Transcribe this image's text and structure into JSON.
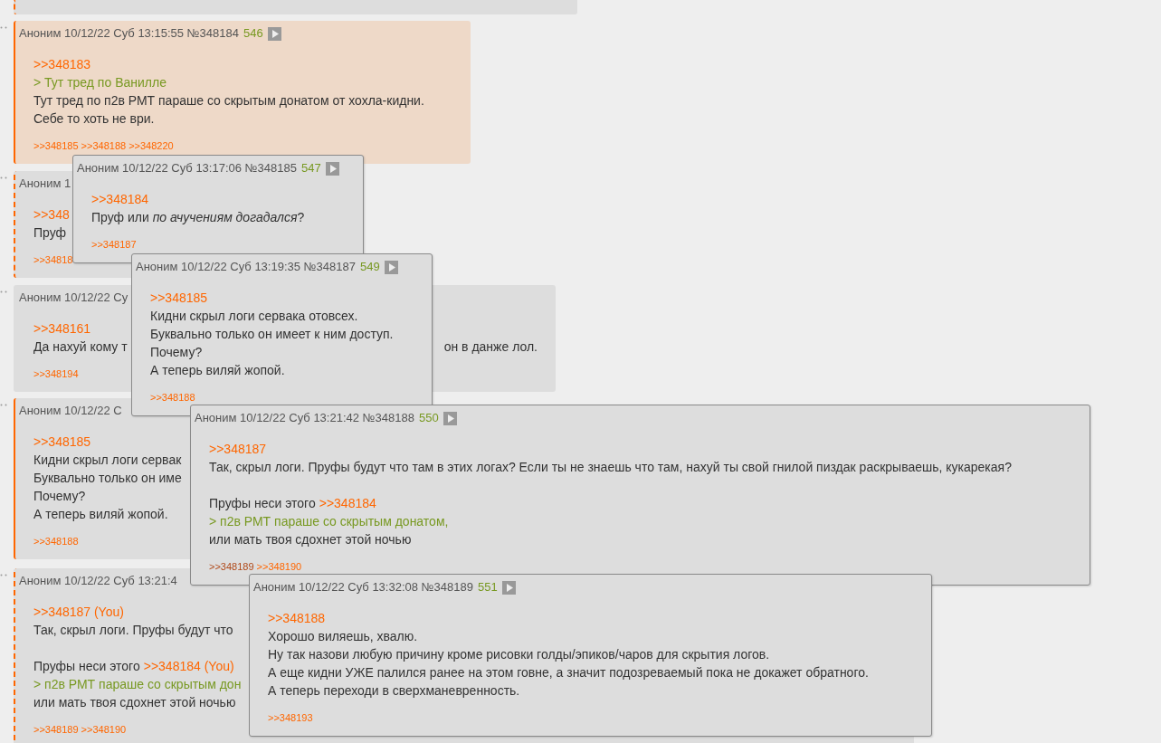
{
  "thread": [
    {
      "kind": "dashed",
      "highlighted": false
    },
    {
      "kind": "solid",
      "highlighted": true,
      "header": {
        "text": "Аноним 10/12/22 Суб 13:15:55 №348184",
        "count": "546"
      },
      "lines": [
        {
          "parts": [
            {
              "kind": "link",
              "text": ">>348183"
            }
          ]
        },
        {
          "parts": [
            {
              "kind": "quote",
              "text": "> Тут тред по Ванилле"
            }
          ]
        },
        {
          "parts": [
            {
              "kind": "text",
              "text": "Тут тред по п2в РМТ параше со скрытым донатом от хохла-кидни."
            }
          ]
        },
        {
          "parts": [
            {
              "kind": "text",
              "text": "Себе то хоть не ври."
            }
          ]
        }
      ],
      "replies": [
        {
          "text": ">>348185",
          "visited": false
        },
        {
          "text": ">>348188",
          "visited": false
        },
        {
          "text": ">>348220",
          "visited": false
        }
      ]
    },
    {
      "kind": "dashed",
      "highlighted": false,
      "header": {
        "text": "Аноним 1"
      },
      "lines": [
        {
          "parts": [
            {
              "kind": "link",
              "text": ">>348"
            }
          ]
        },
        {
          "parts": [
            {
              "kind": "text",
              "text": "Пруф"
            }
          ]
        }
      ],
      "replies": [
        {
          "text": ">>34818",
          "visited": false
        }
      ]
    },
    {
      "kind": "plain",
      "highlighted": false,
      "header": {
        "text": "Аноним 10/12/22 Су"
      },
      "lines": [
        {
          "parts": [
            {
              "kind": "link",
              "text": ">>348161"
            }
          ]
        },
        {
          "parts": [
            {
              "kind": "text",
              "text": "Да нахуй кому т"
            },
            {
              "kind": "text_end",
              "text": "он в данже лол."
            }
          ]
        }
      ],
      "replies": [
        {
          "text": ">>348194",
          "visited": false
        }
      ]
    },
    {
      "kind": "solid",
      "highlighted": false,
      "header": {
        "text": "Аноним 10/12/22 С"
      },
      "lines": [
        {
          "parts": [
            {
              "kind": "link",
              "text": ">>348185"
            }
          ]
        },
        {
          "parts": [
            {
              "kind": "text",
              "text": "Кидни скрыл логи сервак"
            }
          ]
        },
        {
          "parts": [
            {
              "kind": "text",
              "text": "Буквально только он име"
            }
          ]
        },
        {
          "parts": [
            {
              "kind": "text",
              "text": "Почему?"
            }
          ]
        },
        {
          "parts": [
            {
              "kind": "text",
              "text": "А теперь виляй жопой."
            }
          ]
        }
      ],
      "replies": [
        {
          "text": ">>348188",
          "visited": false
        }
      ]
    },
    {
      "kind": "dashed",
      "highlighted": false,
      "header": {
        "text": "Аноним 10/12/22 Суб 13:21:4"
      },
      "lines": [
        {
          "parts": [
            {
              "kind": "link",
              "text": ">>348187 (You)"
            }
          ]
        },
        {
          "parts": [
            {
              "kind": "text",
              "text": "Так, скрыл логи. Пруфы будут что"
            }
          ]
        },
        {
          "spaced": true,
          "parts": [
            {
              "kind": "text",
              "text": "Пруфы неси этого"
            },
            {
              "kind": "link",
              "text": ">>348184 (You)"
            }
          ]
        },
        {
          "parts": [
            {
              "kind": "quote",
              "text": "> п2в РМТ параше со скрытым дон"
            }
          ]
        },
        {
          "parts": [
            {
              "kind": "text",
              "text": "или мать твоя сдохнет этой ночью"
            }
          ]
        }
      ],
      "replies": [
        {
          "text": ">>348189",
          "visited": false
        },
        {
          "text": ">>348190",
          "visited": false
        }
      ]
    }
  ],
  "popups": [
    {
      "header": {
        "text": "Аноним 10/12/22 Суб 13:17:06 №348185",
        "count": "547"
      },
      "lines": [
        {
          "parts": [
            {
              "kind": "link",
              "text": ">>348184"
            }
          ]
        },
        {
          "parts": [
            {
              "kind": "text",
              "text": "Пруф или *по ачучениям догадался*?"
            }
          ]
        }
      ],
      "replies": [
        {
          "text": ">>348187",
          "visited": false
        }
      ]
    },
    {
      "header": {
        "text": "Аноним 10/12/22 Суб 13:19:35 №348187",
        "count": "549"
      },
      "lines": [
        {
          "parts": [
            {
              "kind": "link",
              "text": ">>348185"
            }
          ]
        },
        {
          "parts": [
            {
              "kind": "text",
              "text": "Кидни скрыл логи сервака отовсех."
            }
          ]
        },
        {
          "parts": [
            {
              "kind": "text",
              "text": "Буквально только он имеет к ним доступ."
            }
          ]
        },
        {
          "parts": [
            {
              "kind": "text",
              "text": "Почему?"
            }
          ]
        },
        {
          "parts": [
            {
              "kind": "text",
              "text": "А теперь виляй жопой."
            }
          ]
        }
      ],
      "replies": [
        {
          "text": ">>348188",
          "visited": false
        }
      ]
    },
    {
      "header": {
        "text": "Аноним 10/12/22 Суб 13:21:42 №348188",
        "count": "550"
      },
      "lines": [
        {
          "parts": [
            {
              "kind": "link",
              "text": ">>348187"
            }
          ]
        },
        {
          "parts": [
            {
              "kind": "text",
              "text": "Так, скрыл логи. Пруфы будут что там в этих логах? Если ты не знаешь что там, нахуй ты свой гнилой пиздак раскрываешь, кукарекая?"
            }
          ]
        },
        {
          "spaced": true,
          "parts": [
            {
              "kind": "text",
              "text": "Пруфы неси этого"
            },
            {
              "kind": "link",
              "text": ">>348184"
            }
          ]
        },
        {
          "parts": [
            {
              "kind": "quote",
              "text": "> п2в РМТ параше со скрытым донатом,"
            }
          ]
        },
        {
          "parts": [
            {
              "kind": "text",
              "text": "или мать твоя сдохнет этой ночью"
            }
          ]
        }
      ],
      "replies": [
        {
          "text": ">>348189",
          "visited": true
        },
        {
          "text": ">>348190",
          "visited": false
        }
      ]
    },
    {
      "header": {
        "text": "Аноним 10/12/22 Суб 13:32:08 №348189",
        "count": "551"
      },
      "lines": [
        {
          "parts": [
            {
              "kind": "link",
              "text": ">>348188"
            }
          ]
        },
        {
          "parts": [
            {
              "kind": "text",
              "text": "Хорошо виляешь, хвалю."
            }
          ]
        },
        {
          "parts": [
            {
              "kind": "text",
              "text": "Ну так назови любую причину кроме рисовки голды/эпиков/чаров для скрытия логов."
            }
          ]
        },
        {
          "parts": [
            {
              "kind": "text",
              "text": "А еще кидни УЖЕ палился ранее на этом говне, а значит подозреваемый пока не докажет обратного."
            }
          ]
        },
        {
          "parts": [
            {
              "kind": "text",
              "text": "А теперь переходи в сверхманевренность."
            }
          ]
        }
      ],
      "replies": [
        {
          "text": ">>348193",
          "visited": false
        }
      ]
    }
  ]
}
